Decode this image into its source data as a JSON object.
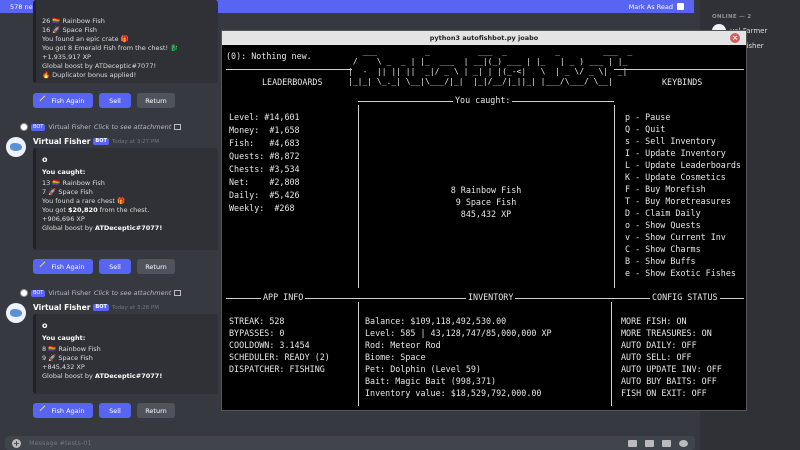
{
  "banner": {
    "text": "578 new messages since 2:56 PM",
    "mark_read": "Mark As Read"
  },
  "chat": {
    "msg1": {
      "lines": [
        "26 🏳️‍🌈 Rainbow Fish",
        "16 🚀 Space Fish",
        "You found an epic crate 🎁",
        "You got 8 Emerald Fish from the chest! 🐉",
        "+1,935,917 XP",
        "Global boost by ATDeceptic#7077!",
        "🔥 Duplicator bonus applied!"
      ]
    },
    "msg2": {
      "reply": {
        "tag": "BOT",
        "author": "Virtual Fisher",
        "hint": "Click to see attachment"
      },
      "author": "Virtual Fisher",
      "bot": "BOT",
      "time": "Today at 3:27 PM",
      "o": "o",
      "caught": "You caught:",
      "line1": "13 🏳️‍🌈 Rainbow Fish",
      "line2": "7 🚀 Space Fish",
      "line3": "You found a rare chest 🎁",
      "line4_pre": "You got ",
      "line4_amt": "$20,820",
      "line4_post": " from the chest.",
      "line5": "+906,696 XP",
      "line6_pre": "Global boost by ",
      "line6_name": "ATDeceptic#7077!"
    },
    "msg3": {
      "reply": {
        "tag": "BOT",
        "author": "Virtual Fisher",
        "hint": "Click to see attachment"
      },
      "author": "Virtual Fisher",
      "bot": "BOT",
      "time": "Today at 3:28 PM",
      "o": "o",
      "caught": "You caught:",
      "line1": "8 🏳️‍🌈 Rainbow Fish",
      "line2": "9 🚀 Space Fish",
      "line3": "+845,432 XP",
      "line4_pre": "Global boost by ",
      "line4_name": "ATDeceptic#7077!"
    },
    "buttons": {
      "fish_again": "Fish Again",
      "sell": "Sell",
      "return": "Return"
    },
    "input_placeholder": "Message #tests-01"
  },
  "members": {
    "head": "ONLINE — 2",
    "m1": "ual Farmer",
    "m2": "ual Fisher",
    "m2_sub": "g /fish"
  },
  "terminal": {
    "title": "python3 autofishbot.py joabo",
    "status": "(0): Nothing new.",
    "logo": [
      "   ___          _          ___  _          _         ___  _",
      " /    \\ _  _ | |_  ___  | __|(_) ___ | |_   | _ ) ___ | |_",
      "|  -  || || ||  _|/ _ \\ | _| | |(_-<|   \\  | _ \\/ _ \\|  _|",
      "|_|_| \\_._| \\__|\\___/|_|  |_|/__/|_||_| |___/\\___/ \\__|"
    ],
    "leaderboards_label": "LEADERBOARDS",
    "keybinds_label": "KEYBINDS",
    "you_caught_label": "You caught:",
    "leaderboards": [
      "Level: #14,601",
      "Money:  #1,658",
      "Fish:   #4,683",
      "Quests: #8,872",
      "Chests: #3,534",
      "Net:    #2,808",
      "Daily:  #5,426",
      "Weekly:  #268"
    ],
    "caught": [
      "8 Rainbow Fish",
      "9 Space Fish",
      "845,432 XP"
    ],
    "keybinds": [
      "p - Pause",
      "Q - Quit",
      "s - Sell Inventory",
      "I - Update Inventory",
      "L - Update Leaderboards",
      "K - Update Cosmetics",
      "F - Buy Morefish",
      "T - Buy Moretreasures",
      "D - Claim Daily",
      "o - Show Quests",
      "v - Show Current Inv",
      "C - Show Charms",
      "B - Show Buffs",
      "e - Show Exotic Fishes"
    ],
    "app_info_label": "APP INFO",
    "inventory_label": "INVENTORY",
    "config_label": "CONFIG STATUS",
    "app_info": [
      "STREAK: 528",
      "BYPASSES: 0",
      "COOLDOWN: 3.1454",
      "SCHEDULER: READY (2)",
      "DISPATCHER: FISHING"
    ],
    "inventory": [
      "Balance: $109,118,492,530.00",
      "Level: 585 | 43,128,747/85,000,000 XP",
      "Rod: Meteor Rod",
      "Biome: Space",
      "Pet: Dolphin (Level 59)",
      "Bait: Magic Bait (998,371)",
      "Inventory value: $18,529,792,000.00"
    ],
    "config": [
      "MORE FISH: ON",
      "MORE TREASURES: ON",
      "AUTO DAILY: OFF",
      "AUTO SELL: OFF",
      "AUTO UPDATE INV: OFF",
      "AUTO BUY BAITS: OFF",
      "FISH ON EXIT: OFF"
    ]
  }
}
